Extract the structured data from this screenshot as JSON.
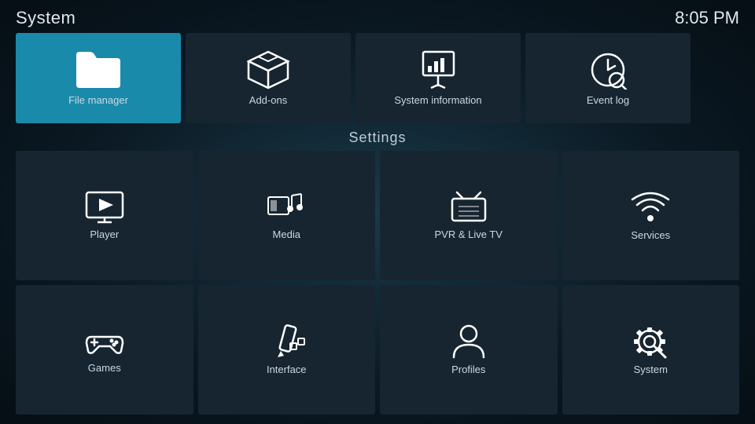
{
  "header": {
    "title": "System",
    "time": "8:05 PM"
  },
  "top_row": [
    {
      "id": "file-manager",
      "label": "File manager",
      "active": true
    },
    {
      "id": "add-ons",
      "label": "Add-ons",
      "active": false
    },
    {
      "id": "system-information",
      "label": "System information",
      "active": false
    },
    {
      "id": "event-log",
      "label": "Event log",
      "active": false
    }
  ],
  "settings_label": "Settings",
  "settings_grid": [
    {
      "id": "player",
      "label": "Player"
    },
    {
      "id": "media",
      "label": "Media"
    },
    {
      "id": "pvr-live-tv",
      "label": "PVR & Live TV"
    },
    {
      "id": "services",
      "label": "Services"
    },
    {
      "id": "games",
      "label": "Games"
    },
    {
      "id": "interface",
      "label": "Interface"
    },
    {
      "id": "profiles",
      "label": "Profiles"
    },
    {
      "id": "system",
      "label": "System"
    }
  ]
}
